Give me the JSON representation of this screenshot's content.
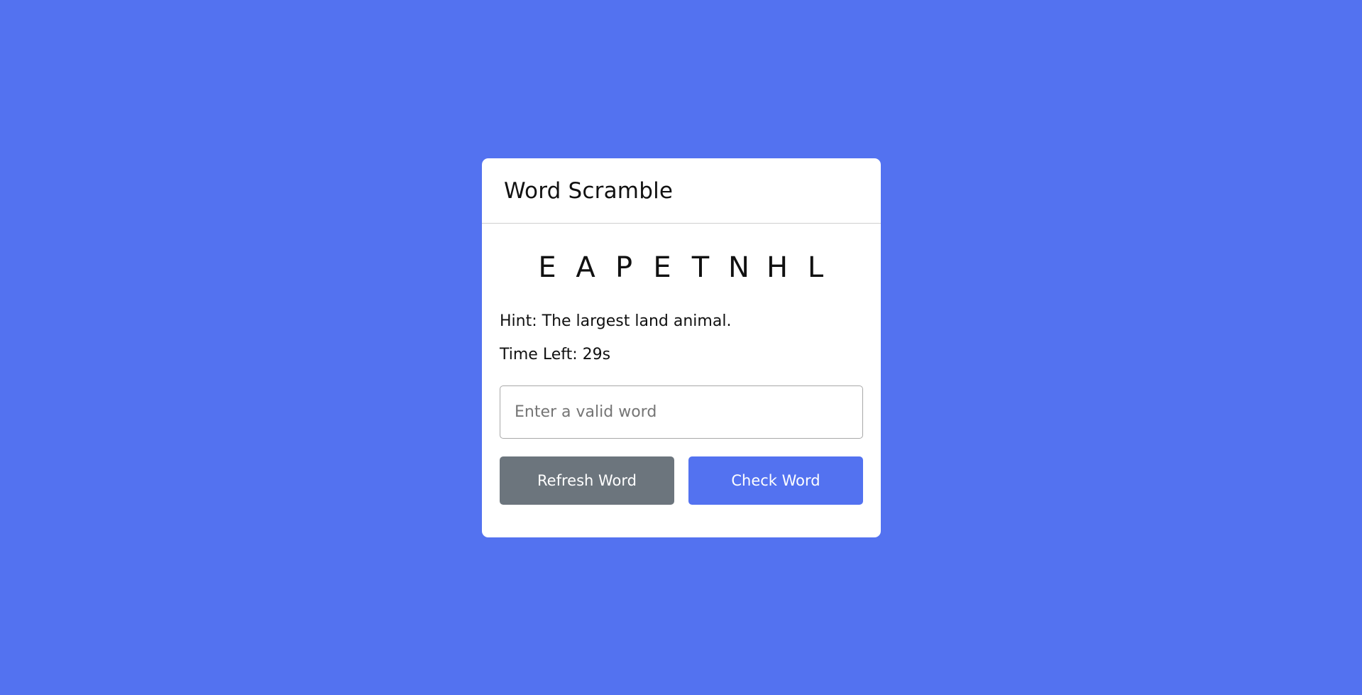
{
  "game": {
    "title": "Word Scramble",
    "scrambled_letters": [
      "E",
      "A",
      "P",
      "E",
      "T",
      "N",
      "H",
      "L"
    ],
    "hint_label": "Hint:",
    "hint_text": "The largest land animal.",
    "time_label": "Time Left:",
    "time_value": "29",
    "time_unit": "s",
    "input": {
      "value": "",
      "placeholder": "Enter a valid word"
    },
    "buttons": {
      "refresh_label": "Refresh Word",
      "check_label": "Check Word"
    }
  },
  "colors": {
    "background": "#5372F0",
    "card": "#FFFFFF",
    "refresh_button": "#6C757D",
    "check_button": "#5372F0"
  }
}
